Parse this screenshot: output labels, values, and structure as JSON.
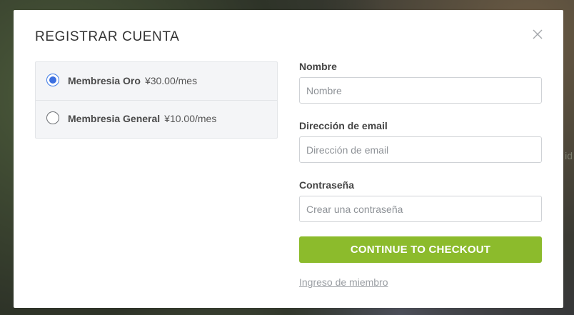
{
  "modal": {
    "title": "REGISTRAR CUENTA",
    "close_icon": "close-icon"
  },
  "plans": [
    {
      "name": "Membresia Oro",
      "price": "¥30.00/mes",
      "selected": true
    },
    {
      "name": "Membresia General",
      "price": "¥10.00/mes",
      "selected": false
    }
  ],
  "form": {
    "name": {
      "label": "Nombre",
      "placeholder": "Nombre",
      "value": ""
    },
    "email": {
      "label": "Dirección de email",
      "placeholder": "Dirección de email",
      "value": ""
    },
    "password": {
      "label": "Contraseña",
      "placeholder": "Crear una contraseña",
      "value": ""
    },
    "submit_label": "CONTINUE TO CHECKOUT",
    "member_login_link": "Ingreso de miembro"
  },
  "colors": {
    "accent_green": "#8cbb2c",
    "radio_blue": "#3b6fe0"
  }
}
